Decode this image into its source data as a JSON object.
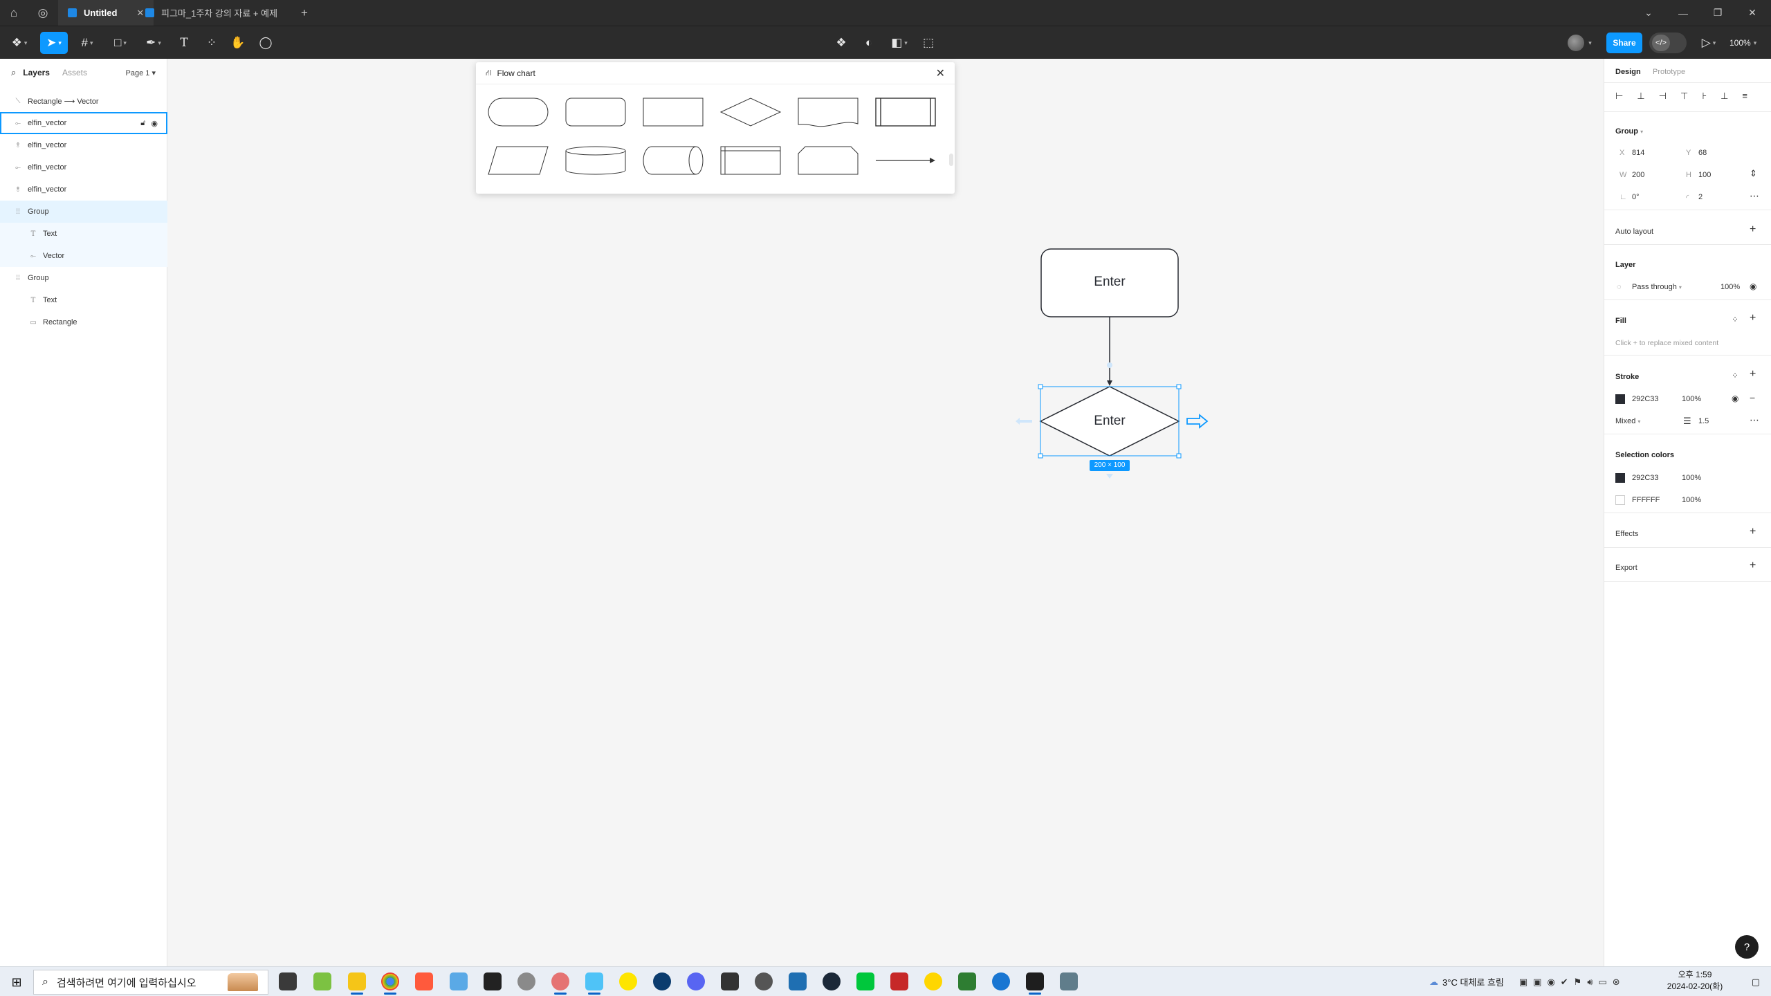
{
  "tabs": [
    {
      "label": "Untitled",
      "active": true
    },
    {
      "label": "피그마_1주차 강의 자료 + 예제",
      "active": false
    }
  ],
  "toolbar": {
    "share_label": "Share",
    "dev_mode_label": "</>",
    "zoom": "100%"
  },
  "layers_panel": {
    "tab_layers": "Layers",
    "tab_assets": "Assets",
    "page": "Page 1",
    "items": [
      {
        "label": "Rectangle ⟶ Vector",
        "icon": "connector-icon"
      },
      {
        "label": "elfin_vector",
        "icon": "vector-icon",
        "selected": true
      },
      {
        "label": "elfin_vector",
        "icon": "vector-icon"
      },
      {
        "label": "elfin_vector",
        "icon": "vector-icon"
      },
      {
        "label": "elfin_vector",
        "icon": "vector-icon"
      },
      {
        "label": "Group",
        "icon": "group-icon"
      },
      {
        "label": "Text",
        "icon": "text-icon"
      },
      {
        "label": "Vector",
        "icon": "vector-icon"
      },
      {
        "label": "Group",
        "icon": "group-icon"
      },
      {
        "label": "Text",
        "icon": "text-icon"
      },
      {
        "label": "Rectangle",
        "icon": "rectangle-icon"
      }
    ]
  },
  "plugin": {
    "title": "Flow chart",
    "shapes": [
      "terminal",
      "rounded-rectangle",
      "process",
      "decision",
      "document",
      "predefined-process",
      "data",
      "database",
      "stored-data",
      "internal-storage",
      "manual-input",
      "arrow"
    ]
  },
  "canvas": {
    "node1_text": "Enter",
    "node2_text": "Enter",
    "size_badge": "200 × 100"
  },
  "design_panel": {
    "tab_design": "Design",
    "tab_prototype": "Prototype",
    "section_title": "Group",
    "x_label": "X",
    "x_value": "814",
    "y_label": "Y",
    "y_value": "68",
    "w_label": "W",
    "w_value": "200",
    "h_label": "H",
    "h_value": "100",
    "rotation": "0°",
    "radius": "2",
    "auto_layout": "Auto layout",
    "layer_title": "Layer",
    "blend_mode": "Pass through",
    "layer_opacity": "100%",
    "fill_title": "Fill",
    "fill_hint": "Click + to replace mixed content",
    "stroke_title": "Stroke",
    "stroke_color": "292C33",
    "stroke_opacity": "100%",
    "stroke_position": "Mixed",
    "stroke_weight": "1.5",
    "selection_colors_title": "Selection colors",
    "selection_colors": [
      {
        "hex": "292C33",
        "opacity": "100%",
        "swatch": "#292C33"
      },
      {
        "hex": "FFFFFF",
        "opacity": "100%",
        "swatch": "#FFFFFF"
      }
    ],
    "effects_title": "Effects",
    "export_title": "Export"
  },
  "help_label": "?",
  "taskbar": {
    "search_placeholder": "검색하려면 여기에 입력하십시오",
    "weather": "3°C  대체로 흐림",
    "time": "오후 1:59",
    "date": "2024-02-20(화)"
  },
  "colors": {
    "accent": "#0d99ff",
    "stroke": "#292C33"
  }
}
